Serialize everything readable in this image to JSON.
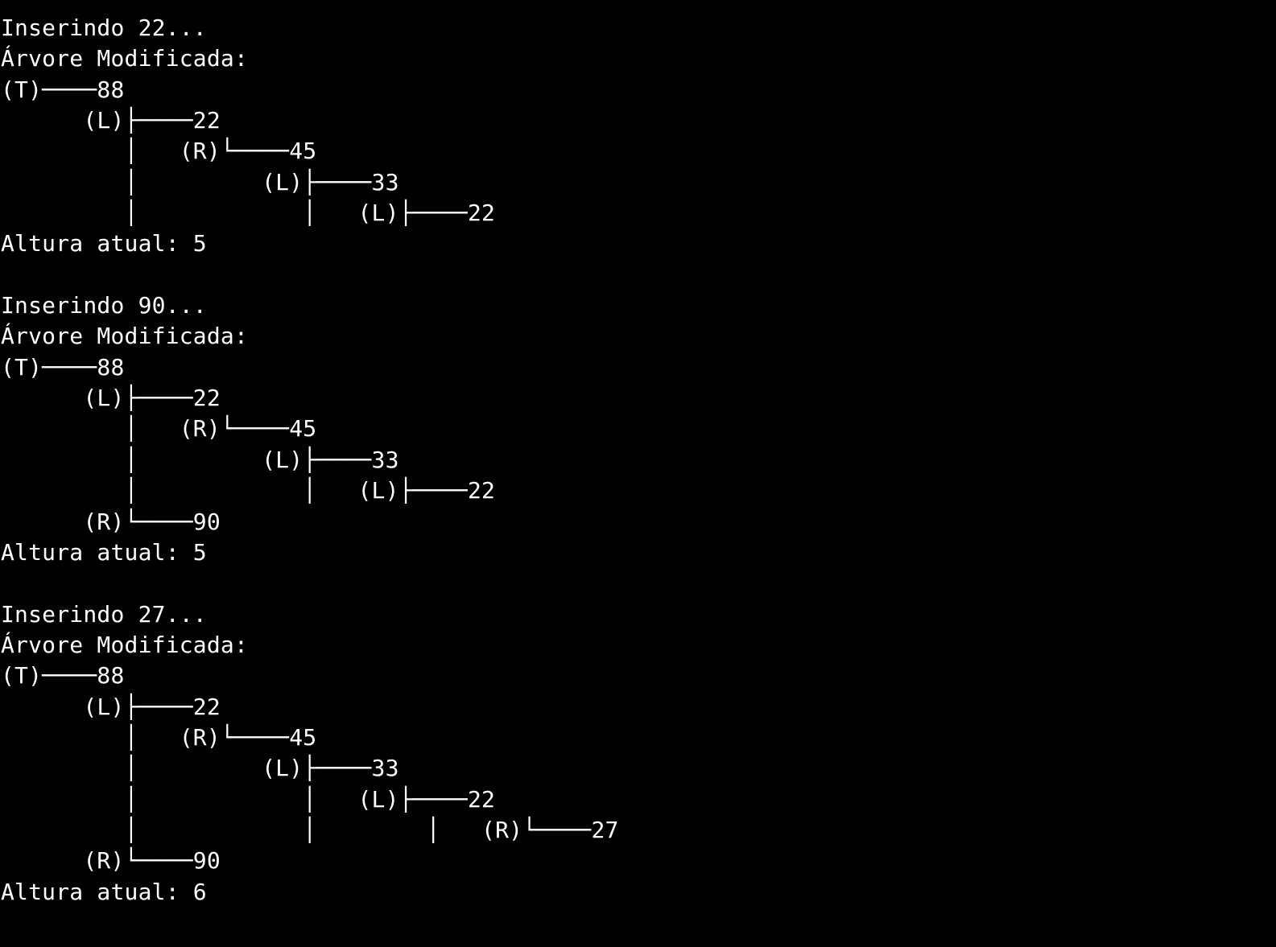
{
  "terminal": {
    "background": "#000000",
    "foreground": "#ffffff",
    "lines": [
      "Inserindo 22...",
      "Árvore Modificada:",
      "(T)────88",
      "      (L)├────22",
      "         │   (R)└────45",
      "         │         (L)├────33",
      "         │            │   (L)├────22",
      "Altura atual: 5",
      "",
      "Inserindo 90...",
      "Árvore Modificada:",
      "(T)────88",
      "      (L)├────22",
      "         │   (R)└────45",
      "         │         (L)├────33",
      "         │            │   (L)├────22",
      "      (R)└────90",
      "Altura atual: 5",
      "",
      "Inserindo 27...",
      "Árvore Modificada:",
      "(T)────88",
      "      (L)├────22",
      "         │   (R)└────45",
      "         │         (L)├────33",
      "         │            │   (L)├────22",
      "         │            │        │   (R)└────27",
      "      (R)└────90",
      "Altura atual: 6"
    ]
  }
}
